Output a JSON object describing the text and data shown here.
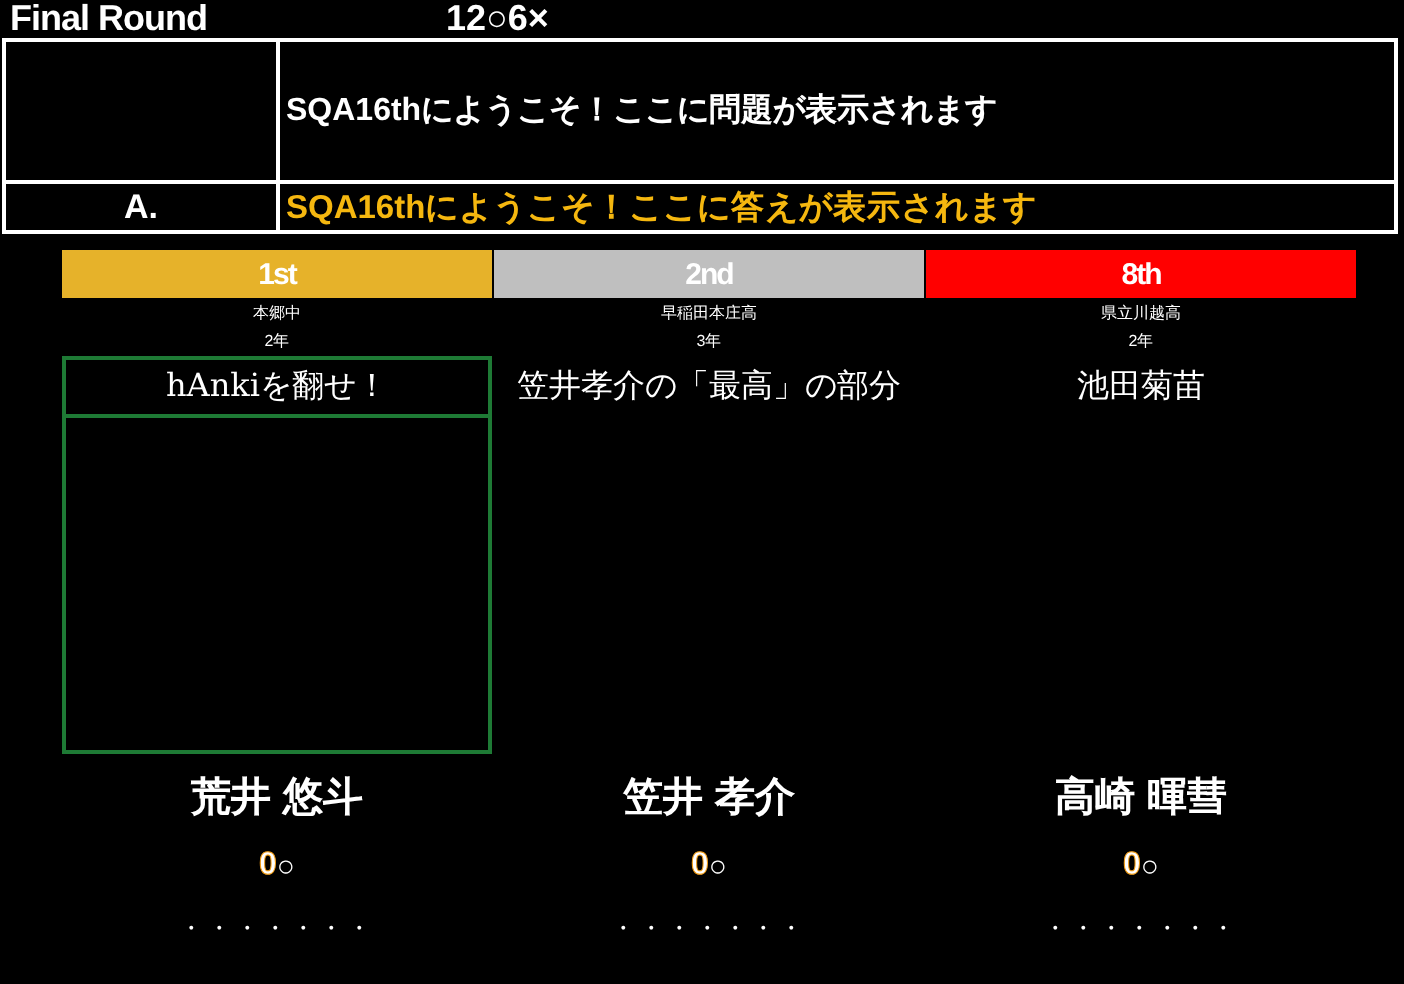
{
  "header": {
    "title": "Final Round",
    "rule": "12○6×"
  },
  "question": {
    "text": "SQA16thにようこそ！ここに問題が表示されます"
  },
  "answer": {
    "label": "A.",
    "text": "SQA16thにようこそ！ここに答えが表示されます"
  },
  "players": [
    {
      "rank": "1st",
      "color": "#e6b22a",
      "school": "本郷中",
      "grade": "2年",
      "nickname": "hAnkiを翻せ！",
      "selected": true,
      "name": "荒井 悠斗",
      "score": "0",
      "mark": "○",
      "slots": "・・・・・・・"
    },
    {
      "rank": "2nd",
      "color": "#bfbfbf",
      "school": "早稲田本庄高",
      "grade": "3年",
      "nickname": "笠井孝介の「最高」の部分",
      "selected": false,
      "name": "笠井 孝介",
      "score": "0",
      "mark": "○",
      "slots": "・・・・・・・"
    },
    {
      "rank": "8th",
      "color": "#ff0000",
      "school": "県立川越高",
      "grade": "2年",
      "nickname": "池田菊苗",
      "selected": false,
      "name": "高崎 暉彗",
      "score": "0",
      "mark": "○",
      "slots": "・・・・・・・"
    }
  ]
}
